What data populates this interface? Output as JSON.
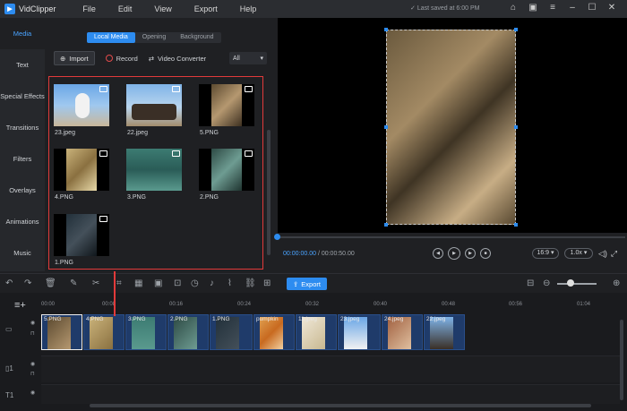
{
  "app": {
    "name": "VidClipper",
    "saved": "Last saved at 6:00 PM"
  },
  "menu": [
    "File",
    "Edit",
    "View",
    "Export",
    "Help"
  ],
  "nav": [
    {
      "label": "Media",
      "active": true
    },
    {
      "label": "Text"
    },
    {
      "label": "Special Effects"
    },
    {
      "label": "Transitions"
    },
    {
      "label": "Filters"
    },
    {
      "label": "Overlays"
    },
    {
      "label": "Animations"
    },
    {
      "label": "Music"
    }
  ],
  "media": {
    "tabs": [
      "Local Media",
      "Opening",
      "Background"
    ],
    "import": "Import",
    "record": "Record",
    "converter": "Video Converter",
    "filter": "All",
    "items": [
      "23.jpeg",
      "22.jpeg",
      "5.PNG",
      "4.PNG",
      "3.PNG",
      "2.PNG",
      "1.PNG"
    ]
  },
  "preview": {
    "current": "00:00:00.00",
    "total": "/ 00:00:50.00",
    "ratio": "16:9",
    "speed": "1.0x"
  },
  "toolbar": {
    "export": "Export"
  },
  "timeline": {
    "ruler": [
      "00:00",
      "00:08",
      "00:16",
      "00:24",
      "00:32",
      "00:40",
      "00:48",
      "00:56",
      "01:04"
    ],
    "clips": [
      "5.PNG",
      "4.PNG",
      "3.PNG",
      "2.PNG",
      "1.PNG",
      "pumpkin",
      "11.jpeg",
      "23.jpeg",
      "24.jpeg",
      "22.jpeg"
    ]
  }
}
